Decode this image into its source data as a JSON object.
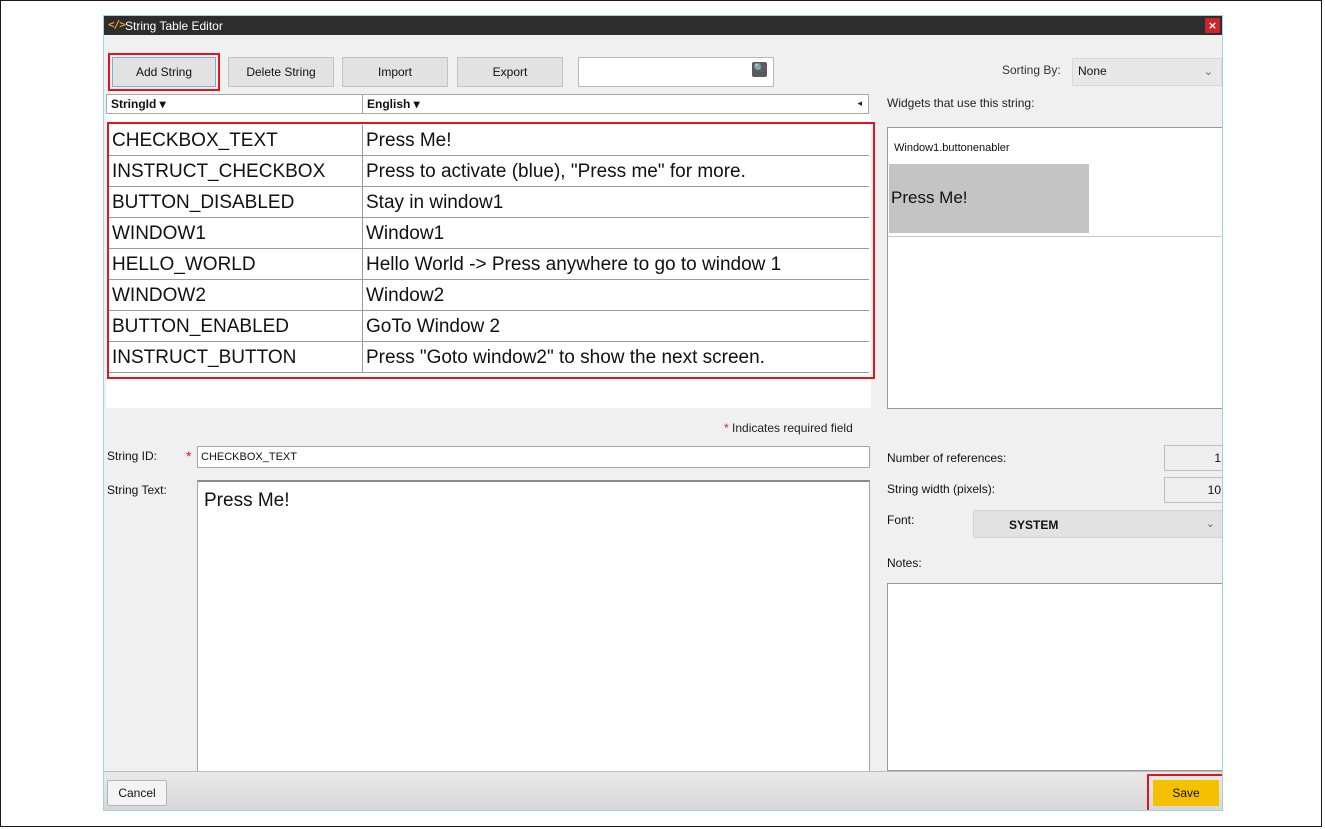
{
  "window": {
    "title": "String Table Editor",
    "close_glyph": "×",
    "icon_glyph": "</>"
  },
  "toolbar": {
    "add_string": "Add String",
    "delete_string": "Delete String",
    "import": "Import",
    "export": "Export",
    "search_value": "",
    "search_icon_glyph": "🔍",
    "sorting_label": "Sorting By:",
    "sorting_value": "None",
    "chevron": "⌄"
  },
  "table": {
    "col_id": "StringId ▾",
    "col_english": "English ▾",
    "scroll_glyph": "◂",
    "rows": [
      {
        "id": "CHECKBOX_TEXT",
        "english": "Press Me!"
      },
      {
        "id": "INSTRUCT_CHECKBOX",
        "english": "Press to activate (blue), \"Press me\" for more."
      },
      {
        "id": "BUTTON_DISABLED",
        "english": "Stay in window1"
      },
      {
        "id": "WINDOW1",
        "english": "Window1"
      },
      {
        "id": "HELLO_WORLD",
        "english": "Hello World -> Press anywhere to go to window 1"
      },
      {
        "id": "WINDOW2",
        "english": "Window2"
      },
      {
        "id": "BUTTON_ENABLED",
        "english": "GoTo Window 2"
      },
      {
        "id": "INSTRUCT_BUTTON",
        "english": "Press \"Goto window2\" to show the next screen."
      }
    ]
  },
  "widgets": {
    "label": "Widgets that use this string:",
    "name": "Window1.buttonenabler",
    "preview_text": "Press Me!"
  },
  "form": {
    "required_star": "*",
    "required_note": "Indicates required field",
    "string_id_label": "String ID:",
    "string_id_value": "CHECKBOX_TEXT",
    "string_text_label": "String Text:",
    "string_text_value": "Press Me!"
  },
  "details": {
    "refs_label": "Number of references:",
    "refs_value": "1",
    "width_label": "String width (pixels):",
    "width_value": "10",
    "font_label": "Font:",
    "font_value": "SYSTEM",
    "notes_label": "Notes:",
    "notes_value": ""
  },
  "footer": {
    "cancel": "Cancel",
    "save": "Save"
  },
  "colors": {
    "highlight": "#e0151f",
    "save": "#f5c000",
    "titlebar": "#2d2d2d"
  }
}
